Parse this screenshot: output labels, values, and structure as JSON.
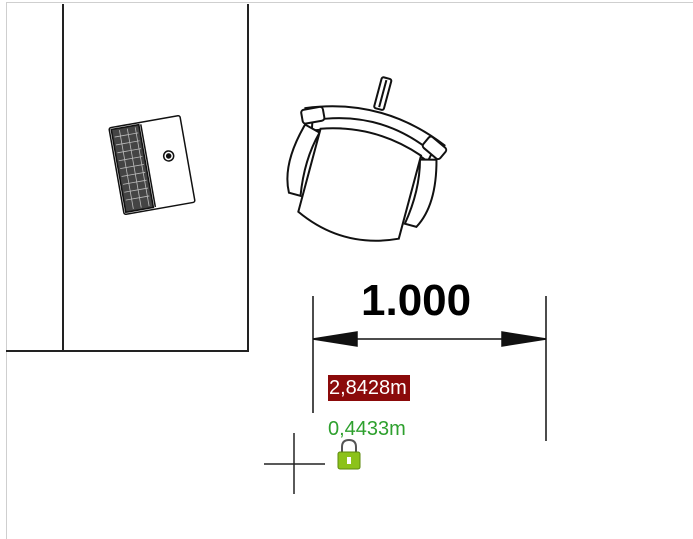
{
  "dimension": {
    "value_label": "1.000"
  },
  "dynamic_input": {
    "length_value": "2,8428m",
    "secondary_value": "0,4433m"
  },
  "colors": {
    "input_highlight": "#8b0a0a",
    "secondary_text": "#2ea02e",
    "lock_icon": "#8cc21a"
  },
  "icons": {
    "lock": "lock-icon",
    "cursor": "crosshair-cursor-icon"
  }
}
